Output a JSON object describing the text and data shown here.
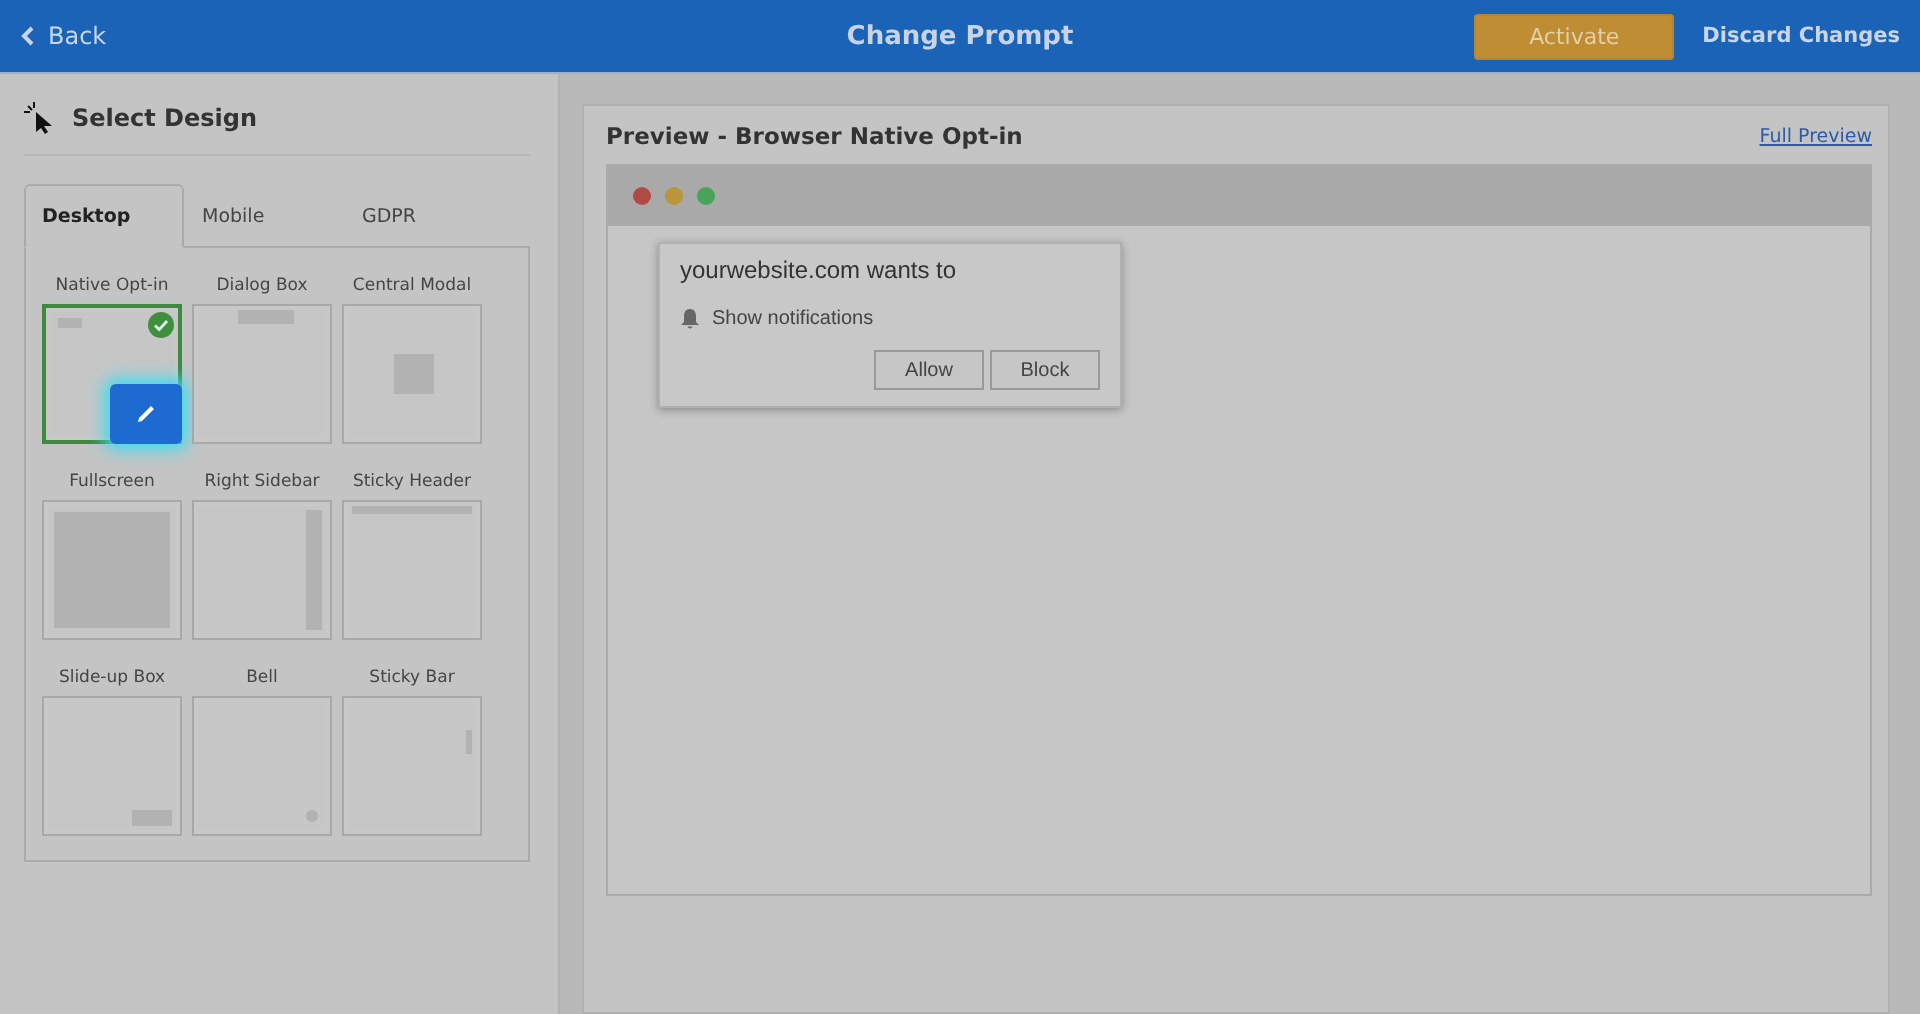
{
  "header": {
    "back": "Back",
    "title": "Change Prompt",
    "activate": "Activate",
    "discard": "Discard Changes"
  },
  "design_panel": {
    "title": "Select Design",
    "tabs": [
      {
        "label": "Desktop",
        "selected": true
      },
      {
        "label": "Mobile",
        "selected": false
      },
      {
        "label": "GDPR",
        "selected": false
      }
    ],
    "designs": [
      {
        "label": "Native Opt-in",
        "kind": "native",
        "selected": true
      },
      {
        "label": "Dialog Box",
        "kind": "dialog",
        "selected": false
      },
      {
        "label": "Central Modal",
        "kind": "modal",
        "selected": false
      },
      {
        "label": "Fullscreen",
        "kind": "fullscreen",
        "selected": false
      },
      {
        "label": "Right Sidebar",
        "kind": "sidebar",
        "selected": false
      },
      {
        "label": "Sticky Header",
        "kind": "header",
        "selected": false
      },
      {
        "label": "Slide-up Box",
        "kind": "slideup",
        "selected": false
      },
      {
        "label": "Bell",
        "kind": "bell",
        "selected": false
      },
      {
        "label": "Sticky Bar",
        "kind": "bar",
        "selected": false
      }
    ]
  },
  "preview": {
    "title": "Preview - Browser Native Opt-in",
    "full_preview": "Full Preview",
    "prompt": {
      "heading": "yourwebsite.com wants to",
      "permission": "Show notifications",
      "buttons": [
        "Allow",
        "Block"
      ]
    }
  }
}
